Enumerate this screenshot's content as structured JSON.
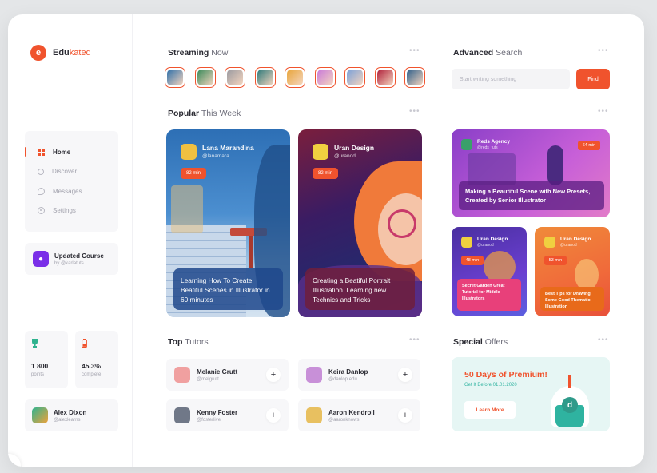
{
  "brand": {
    "mark": "e",
    "name_prefix": "Edu",
    "name_suffix": "kated"
  },
  "sidebar": {
    "nav": [
      {
        "label": "Home",
        "icon": "home-grid-icon",
        "active": true
      },
      {
        "label": "Discover",
        "icon": "search-icon"
      },
      {
        "label": "Messages",
        "icon": "message-icon"
      },
      {
        "label": "Settings",
        "icon": "gear-icon"
      }
    ],
    "course": {
      "title": "Updated Course",
      "subtitle": "by @karlatuts",
      "icon": "lightbulb-icon"
    },
    "stats": [
      {
        "value": "1 800",
        "label": "points",
        "icon": "trophy-icon"
      },
      {
        "value": "45.3%",
        "label": "complete",
        "icon": "battery-icon"
      }
    ],
    "user": {
      "name": "Alex Dixon",
      "handle": "@alexlearns"
    }
  },
  "streaming": {
    "title_bold": "Streaming",
    "title_light": "Now",
    "dots": "•••",
    "avatars": [
      "#2f6fa8",
      "#3a8a5a",
      "#9a9aa0",
      "#2f7a7a",
      "#e8a53a",
      "#c97ad8",
      "#7aa0d8",
      "#b0203a",
      "#2f5f8a"
    ]
  },
  "popular": {
    "title_bold": "Popular",
    "title_light": "This Week",
    "dots": "•••",
    "cards": [
      {
        "name": "Lana Marandina",
        "handle": "@lanamara",
        "badge": "82 min",
        "description": "Learning How To Create Beatiful Scenes in Illustrator in 60 minutes"
      },
      {
        "name": "Uran Design",
        "handle": "@uranod",
        "badge": "82 min",
        "description": "Creating a Beatiful Portrait Illustration. Learning new Technics and Tricks"
      }
    ]
  },
  "search": {
    "title_bold": "Advanced",
    "title_light": "Search",
    "dots": "•••",
    "placeholder": "Start writing something",
    "value": "",
    "button": "Find"
  },
  "right_cards": [
    {
      "name": "Reds Agency",
      "handle": "@reds_tuts",
      "badge": "64 min",
      "description": "Making a Beautiful Scene with New Presets, Created by Senior Illustrator"
    },
    {
      "name": "Uran Design",
      "handle": "@uranod",
      "badge": "48 min",
      "description": "Secret Garden Great Tutorial for Middle Illustrators"
    },
    {
      "name": "Uran Design",
      "handle": "@uranod",
      "badge": "53 min",
      "description": "Best Tips for Drawing Some Good Thematic Illustration"
    }
  ],
  "tutors": {
    "title_bold": "Top",
    "title_light": "Tutors",
    "dots": "•••",
    "items": [
      {
        "name": "Melanie Grutt",
        "handle": "@melgrutt",
        "color": "#f0a0a0"
      },
      {
        "name": "Keira Danlop",
        "handle": "@danlop.edu",
        "color": "#c890d8"
      },
      {
        "name": "Kenny Foster",
        "handle": "@fosterlive",
        "color": "#707888"
      },
      {
        "name": "Aaron Kendroll",
        "handle": "@aaronknows",
        "color": "#e8c060"
      }
    ],
    "add_label": "+"
  },
  "offers": {
    "title_bold": "Special",
    "title_light": "Offers",
    "dots": "•••",
    "headline": "50 Days of Premium!",
    "sub": "Get It Before 01.01.2020",
    "button": "Learn More",
    "cake_letter": "d"
  }
}
